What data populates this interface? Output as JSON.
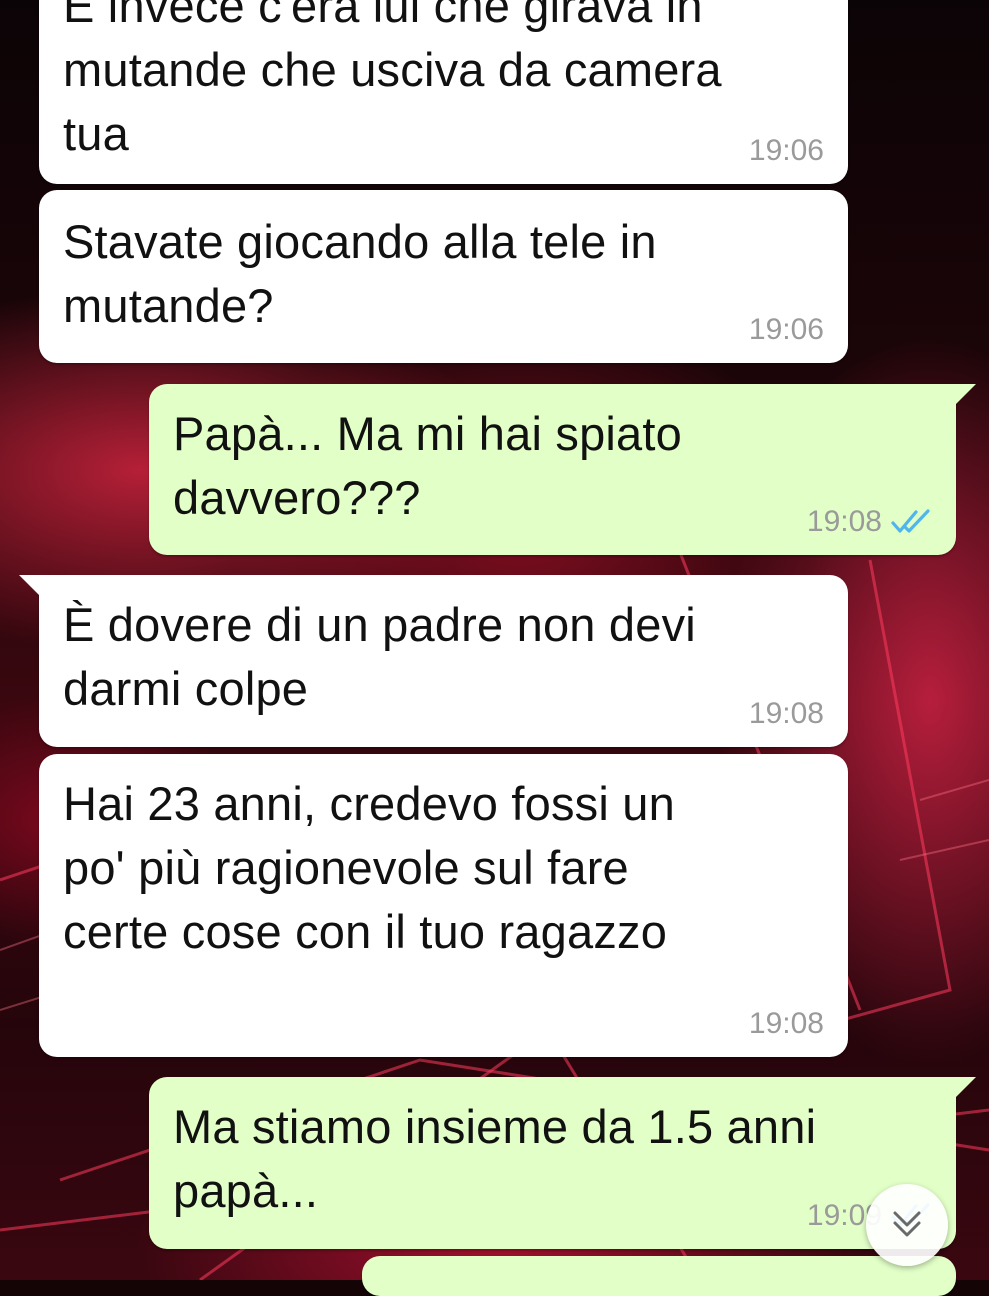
{
  "colors": {
    "incoming_bubble": "#ffffff",
    "outgoing_bubble": "#e2ffc8",
    "timestamp": "#9a9a9a",
    "read_tick": "#4fb6ec"
  },
  "messages": [
    {
      "direction": "in",
      "lines": [
        "E invece c'era lui che girava in",
        "mutande che usciva da camera",
        "tua"
      ],
      "time": "19:06"
    },
    {
      "direction": "in",
      "lines": [
        "Stavate giocando alla tele in",
        "mutande?"
      ],
      "time": "19:06"
    },
    {
      "direction": "out",
      "lines": [
        "Papà... Ma mi hai spiato",
        "davvero???"
      ],
      "time": "19:08",
      "status_icon": "double-check-read-icon"
    },
    {
      "direction": "in",
      "lines": [
        "È dovere di un padre non devi",
        "darmi colpe"
      ],
      "time": "19:08"
    },
    {
      "direction": "in",
      "lines": [
        "Hai 23 anni, credevo fossi un",
        "po' più ragionevole sul fare",
        "certe cose con il tuo ragazzo"
      ],
      "time": "19:08"
    },
    {
      "direction": "out",
      "lines": [
        "Ma stiamo insieme da 1.5 anni",
        "papà..."
      ],
      "time": "19:09",
      "status_icon": "double-check-read-icon"
    }
  ],
  "scroll_button_icon": "chevron-double-down-icon"
}
